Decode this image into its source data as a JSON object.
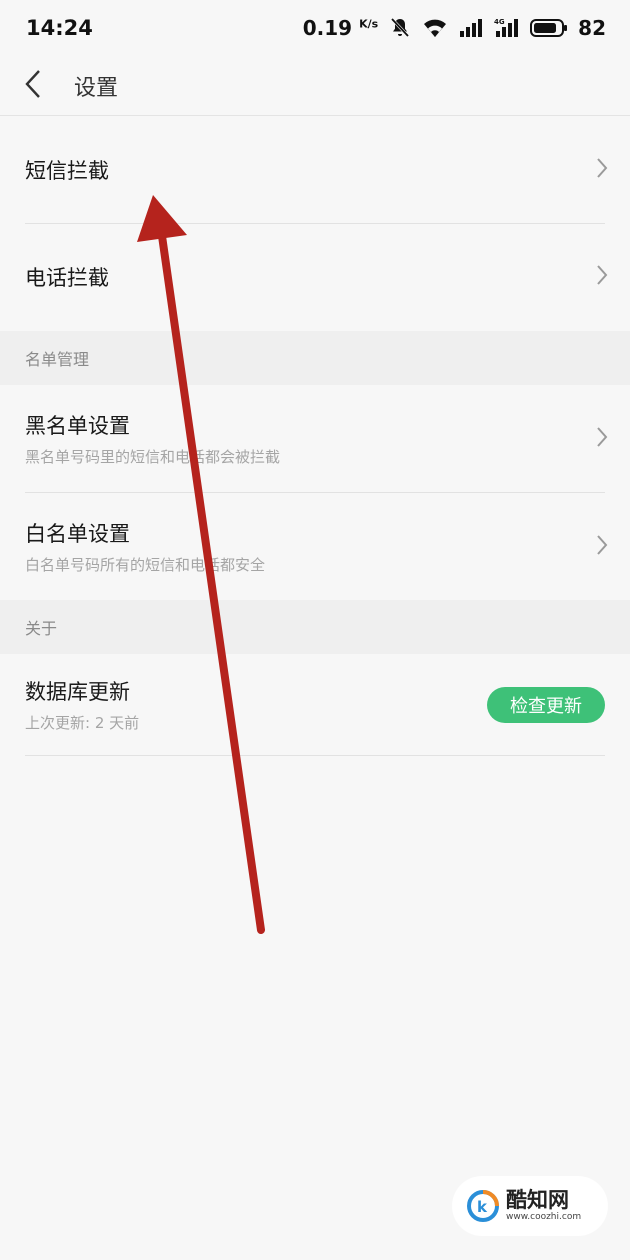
{
  "status_bar": {
    "time": "14:24",
    "net_speed": "0.19",
    "net_unit": "K/s",
    "battery": "82"
  },
  "header": {
    "title": "设置"
  },
  "rows": {
    "sms_block": {
      "title": "短信拦截"
    },
    "call_block": {
      "title": "电话拦截"
    },
    "blacklist": {
      "title": "黑名单设置",
      "subtitle": "黑名单号码里的短信和电话都会被拦截"
    },
    "whitelist": {
      "title": "白名单设置",
      "subtitle": "白名单号码所有的短信和电话都安全"
    },
    "database": {
      "title": "数据库更新",
      "subtitle": "上次更新: 2 天前",
      "button": "检查更新"
    }
  },
  "sections": {
    "list_management": "名单管理",
    "about": "关于"
  },
  "watermark": {
    "name": "酷知网",
    "url": "www.coozhi.com"
  },
  "colors": {
    "accent_green": "#3ec178",
    "annotation_arrow": "#b5231d"
  }
}
